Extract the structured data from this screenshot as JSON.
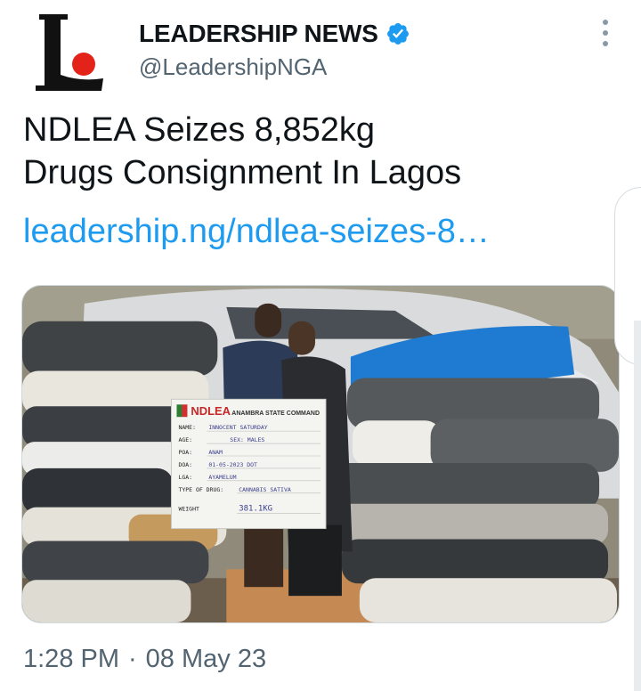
{
  "account": {
    "display_name": "LEADERSHIP NEWS",
    "handle": "@LeadershipNGA",
    "logo_letter": "L",
    "verified": true
  },
  "tweet": {
    "text_lines": [
      "NDLEA Seizes 8,852kg",
      "Drugs Consignment In Lagos"
    ],
    "link": "leadership.ng/ndlea-seizes-8…"
  },
  "media": {
    "sign": {
      "org": "NDLEA",
      "command": "ANAMBRA STATE COMMAND",
      "fields": [
        {
          "label": "NAME:",
          "value": "INNOCENT SATURDAY"
        },
        {
          "label": "AGE:",
          "value": "SEX: MALES"
        },
        {
          "label": "POA:",
          "value": "ANAM"
        },
        {
          "label": "DOA:",
          "value": "01-05-2023 DOT"
        },
        {
          "label": "LGA:",
          "value": "AYAMELUM"
        },
        {
          "label": "TYPE OF DRUG:",
          "value": "CANNABIS SATIVA"
        },
        {
          "label": "WEIGHT",
          "value": "381.1KG"
        }
      ]
    }
  },
  "timestamp": {
    "time": "1:28 PM",
    "separator": "·",
    "date": "08 May 23"
  },
  "colors": {
    "link": "#1d9bf0",
    "secondary_text": "#536471",
    "verified_badge": "#1d9bf0",
    "logo_dot": "#e32219"
  },
  "icons": [
    "verified-badge-icon",
    "more-options-icon"
  ]
}
